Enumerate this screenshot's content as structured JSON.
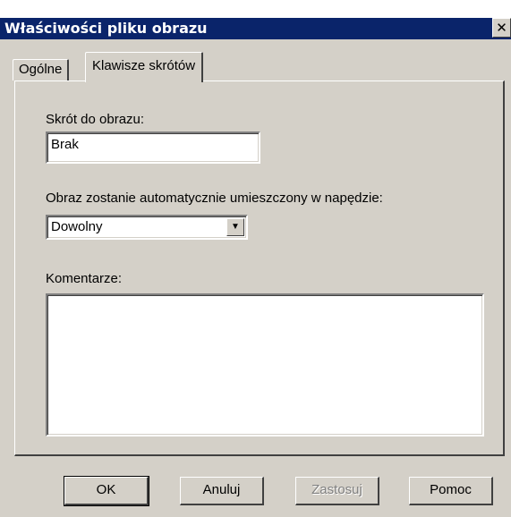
{
  "window": {
    "title": "Właściwości pliku obrazu",
    "close_glyph": "✕"
  },
  "tabs": [
    {
      "label": "Ogólne",
      "active": false
    },
    {
      "label": "Klawisze skrótów",
      "active": true
    }
  ],
  "form": {
    "shortcut_label": "Skrót do obrazu:",
    "shortcut_value": "Brak",
    "drive_label": "Obraz zostanie automatycznie umieszczony w napędzie:",
    "drive_value": "Dowolny",
    "comments_label": "Komentarze:",
    "comments_value": ""
  },
  "buttons": {
    "ok": "OK",
    "cancel": "Anuluj",
    "apply": "Zastosuj",
    "help": "Pomoc"
  },
  "icons": {
    "close": "close-icon",
    "dropdown": "chevron-down-icon"
  }
}
